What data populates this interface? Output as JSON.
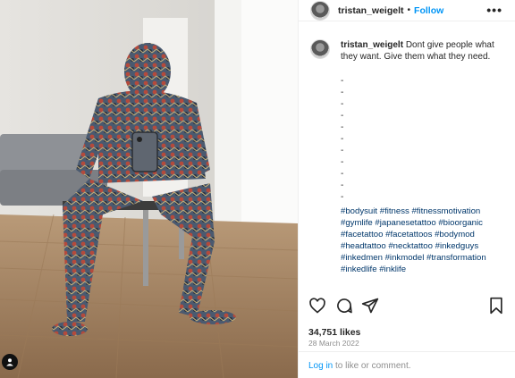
{
  "header": {
    "username": "tristan_weigelt",
    "separator": "•",
    "follow_label": "Follow",
    "more_icon": "more-horizontal-icon"
  },
  "caption": {
    "username": "tristan_weigelt",
    "text": "Dont give people what they want. Give them what they need.",
    "dashes": [
      "-",
      "-",
      "-",
      "-",
      "-",
      "-",
      "-",
      "-",
      "-",
      "-",
      "-"
    ],
    "hashtags": "#bodysuit #fitness #fitnessmotivation #gymlife #japanesetattoo #bioorganic #facetattoo #facetattoos #bodymod #headtattoo #necktattoo #inkedguys #inkedmen #inkmodel #transformation #inkedlife #inklife"
  },
  "actions": {
    "icons": [
      "heart-icon",
      "comment-icon",
      "share-icon",
      "bookmark-icon"
    ]
  },
  "likes": "34,751 likes",
  "date": "28 March 2022",
  "login": {
    "link": "Log in",
    "rest": " to like or comment."
  },
  "colors": {
    "link_blue": "#0095f6",
    "hashtag": "#00376b",
    "muted": "#8e8e8e"
  }
}
